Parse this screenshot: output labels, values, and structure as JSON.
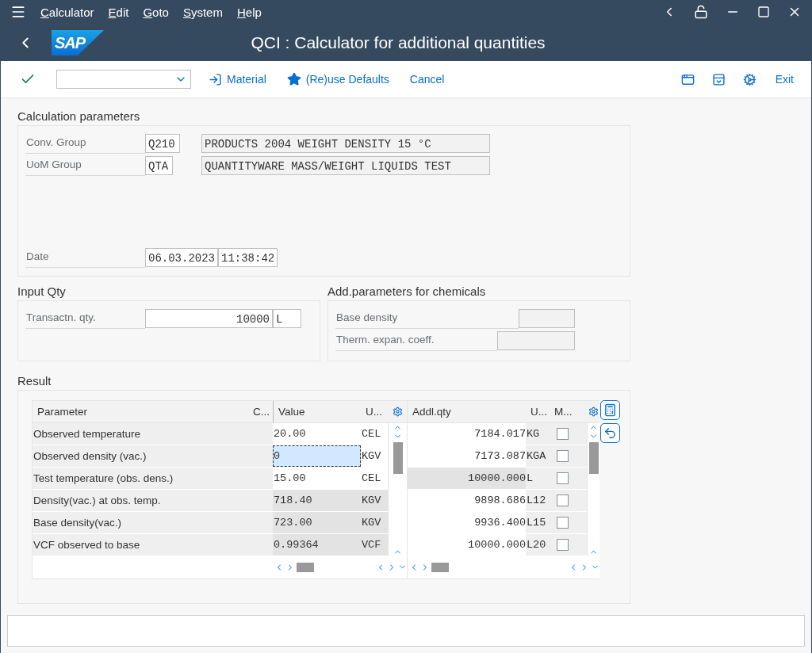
{
  "menu_bar": {
    "items": [
      "Calculator",
      "Edit",
      "Goto",
      "System",
      "Help"
    ]
  },
  "header": {
    "logo": "SAP",
    "title": "QCI : Calculator for additional quantities"
  },
  "toolbar": {
    "buttons": [
      {
        "kind": "material",
        "label": "Material"
      },
      {
        "kind": "defaults",
        "label": "(Re)use Defaults"
      },
      {
        "kind": "plain",
        "label": "Cancel"
      }
    ],
    "exit": "Exit"
  },
  "calculation_parameters": {
    "title": "Calculation parameters",
    "fields": [
      {
        "label": "Conv. Group",
        "code": "Q210",
        "description": "PRODUCTS 2004 WEIGHT DENSITY 15 °C"
      },
      {
        "label": "UoM Group",
        "code": "QTA",
        "description": "QUANTITYWARE MASS/WEIGHT LIQUIDS TEST"
      }
    ],
    "date": {
      "label": "Date",
      "date": "06.03.2023",
      "time": "11:38:42"
    }
  },
  "input_qty": {
    "title": "Input Qty",
    "label": "Transactn. qty.",
    "value": "10000",
    "unit": "L"
  },
  "chemicals": {
    "title": "Add.parameters for chemicals",
    "fields": [
      {
        "label": "Base density"
      },
      {
        "label": "Therm. expan. coeff."
      }
    ]
  },
  "result": {
    "title": "Result",
    "parameter_table": {
      "columns": [
        "Parameter",
        "C...",
        "Value",
        "U..."
      ],
      "rows": [
        {
          "parameter": "Observed temperature",
          "value": "20.00",
          "unit": "CEL",
          "editable": true,
          "focused": false
        },
        {
          "parameter": "Observed density (vac.)",
          "value": "0",
          "unit": "KGV",
          "editable": true,
          "focused": true
        },
        {
          "parameter": "Test temperature (obs. dens.)",
          "value": "15.00",
          "unit": "CEL",
          "editable": true,
          "focused": false
        },
        {
          "parameter": "Density(vac.) at obs. temp.",
          "value": "718.40",
          "unit": "KGV",
          "editable": false,
          "focused": false
        },
        {
          "parameter": "Base density(vac.)",
          "value": "723.00",
          "unit": "KGV",
          "editable": false,
          "focused": false
        },
        {
          "parameter": "VCF observed to base",
          "value": "0.99364",
          "unit": "VCF",
          "editable": false,
          "focused": false
        }
      ]
    },
    "quantity_table": {
      "columns": [
        "Addl.qty",
        "U...",
        "M..."
      ],
      "rows": [
        {
          "quantity": "7184.017",
          "unit": "KG",
          "editable": true,
          "checked": false
        },
        {
          "quantity": "7173.087",
          "unit": "KGA",
          "editable": true,
          "checked": false
        },
        {
          "quantity": "10000.000",
          "unit": "L",
          "editable": false,
          "checked": false
        },
        {
          "quantity": "9898.686",
          "unit": "L12",
          "editable": true,
          "checked": false
        },
        {
          "quantity": "9936.400",
          "unit": "L15",
          "editable": true,
          "checked": false
        },
        {
          "quantity": "10000.000",
          "unit": "L20",
          "editable": true,
          "checked": false
        }
      ]
    }
  }
}
